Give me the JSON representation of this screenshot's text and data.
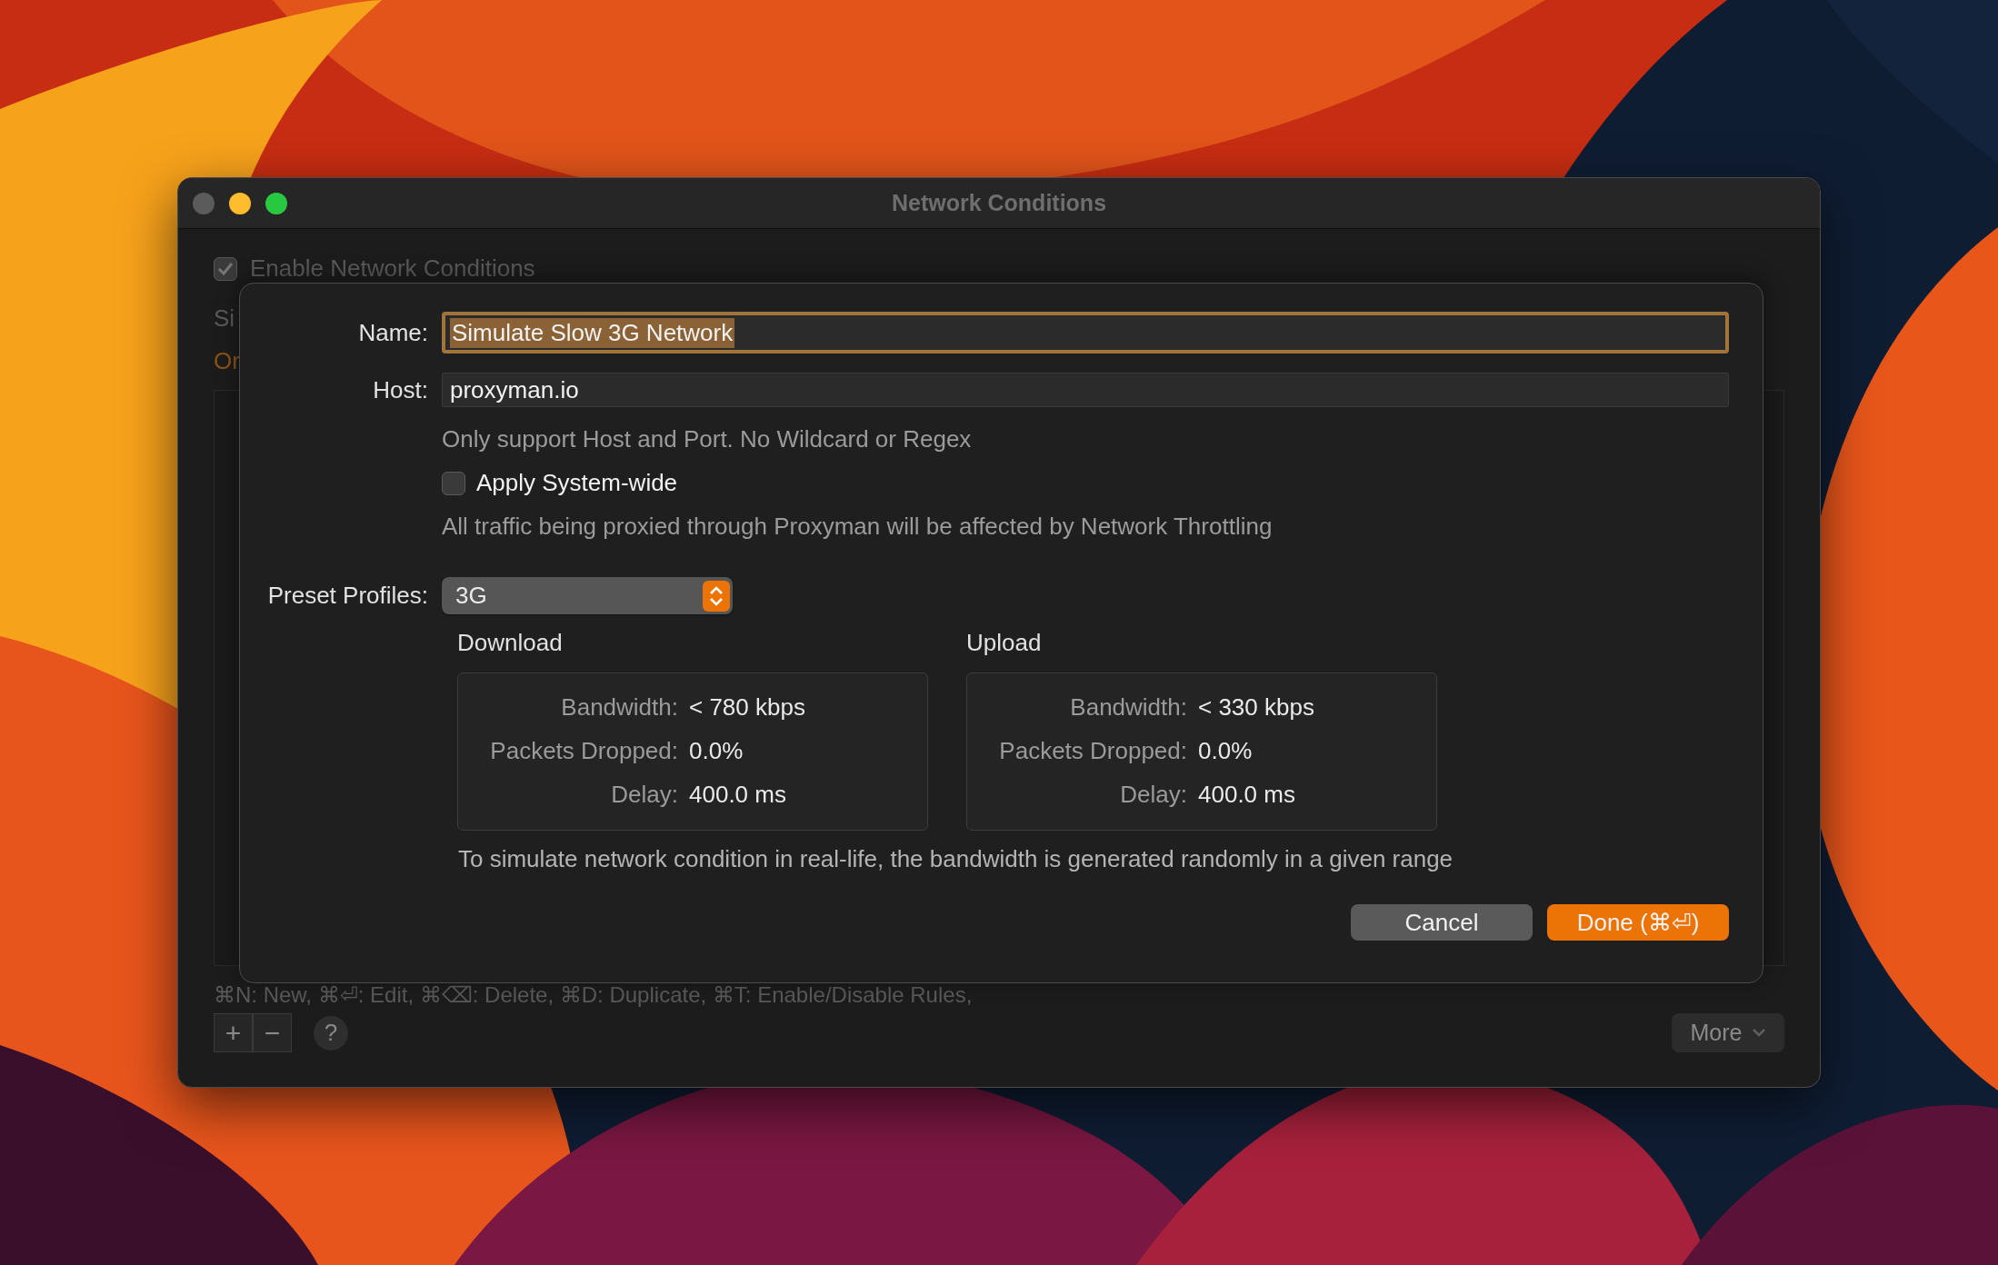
{
  "window": {
    "title": "Network Conditions"
  },
  "background_panel": {
    "enable": {
      "label": "Enable Network Conditions",
      "checked": true
    },
    "cut_texts": [
      {
        "text": "Si",
        "kind": "plain"
      },
      {
        "text": "Or",
        "kind": "accent"
      }
    ],
    "shortcut_hint": "⌘N: New, ⌘⏎: Edit, ⌘⌫: Delete, ⌘D: Duplicate, ⌘T: Enable/Disable Rules,",
    "add_button": "+",
    "remove_button": "−",
    "help_button": "?",
    "more_button": "More"
  },
  "sheet": {
    "name": {
      "label": "Name:",
      "value": "Simulate Slow 3G Network"
    },
    "host": {
      "label": "Host:",
      "value": "proxyman.io"
    },
    "host_note": "Only support Host and Port. No Wildcard or Regex",
    "system_wide": {
      "label": "Apply System-wide",
      "checked": false
    },
    "system_wide_note": "All traffic being proxied through Proxyman will be affected by Network Throttling",
    "preset": {
      "label": "Preset Profiles:",
      "value": "3G"
    },
    "groups": [
      {
        "title": "Download",
        "rows": [
          {
            "label": "Bandwidth:",
            "value": "< 780 kbps"
          },
          {
            "label": "Packets Dropped:",
            "value": "0.0%"
          },
          {
            "label": "Delay:",
            "value": "400.0 ms"
          }
        ]
      },
      {
        "title": "Upload",
        "rows": [
          {
            "label": "Bandwidth:",
            "value": "< 330 kbps"
          },
          {
            "label": "Packets Dropped:",
            "value": "0.0%"
          },
          {
            "label": "Delay:",
            "value": "400.0 ms"
          }
        ]
      }
    ],
    "footnote": "To simulate network condition in real-life, the bandwidth is generated randomly in a given range",
    "buttons": [
      {
        "label": "Cancel",
        "kind": "secondary"
      },
      {
        "label": "Done (⌘⏎)",
        "kind": "primary"
      }
    ]
  }
}
